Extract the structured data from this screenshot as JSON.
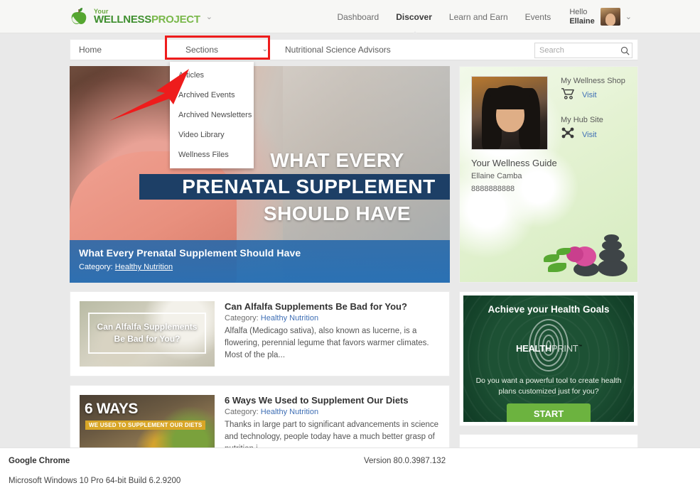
{
  "header": {
    "brand": {
      "line1": "Your",
      "wellness": "WELLNESS",
      "project": "PROJECT",
      "tm": "®",
      "caret": "⌄"
    },
    "nav": [
      {
        "label": "Dashboard",
        "active": false
      },
      {
        "label": "Discover",
        "active": true
      },
      {
        "label": "Learn and Earn",
        "active": false
      },
      {
        "label": "Events",
        "active": false
      }
    ],
    "greeting": "Hello",
    "user_name": "Ellaine",
    "user_caret": "⌄"
  },
  "subnav": {
    "home": "Home",
    "sections": "Sections",
    "sections_caret": "⌄",
    "advisors": "Nutritional Science Advisors",
    "search_placeholder": "Search",
    "search_value": ""
  },
  "dropdown": {
    "items": [
      {
        "label": "Articles"
      },
      {
        "label": "Archived Events"
      },
      {
        "label": "Archived Newsletters"
      },
      {
        "label": "Video Library"
      },
      {
        "label": "Wellness Files"
      }
    ]
  },
  "hero": {
    "overlay_line1": "WHAT EVERY",
    "overlay_line2": "PRENATAL SUPPLEMENT",
    "overlay_line3": "SHOULD HAVE",
    "title": "What Every Prenatal Supplement Should Have",
    "category_label": "Category:",
    "category": "Healthy Nutrition"
  },
  "articles": [
    {
      "thumb_line1": "Can Alfalfa Supplements",
      "thumb_line2": "Be Bad for You?",
      "title": "Can Alfalfa Supplements Be Bad for You?",
      "category_label": "Category:",
      "category": "Healthy Nutrition",
      "excerpt": "Alfalfa (Medicago sativa), also known as lucerne, is a flowering, perennial legume that favors warmer climates. Most of the pla..."
    },
    {
      "thumb_line1": "6 WAYS",
      "thumb_line2": "WE USED TO SUPPLEMENT OUR DIETS",
      "title": "6 Ways We Used to Supplement Our Diets",
      "category_label": "Category:",
      "category": "Healthy Nutrition",
      "excerpt": "Thanks in large part to significant advancements in science and technology, people today have a much better grasp of nutrition i..."
    }
  ],
  "sidebar": {
    "guide_label": "Your Wellness Guide",
    "guide_name": "Ellaine Camba",
    "guide_phone": "8888888888",
    "shop_title": "My Wellness Shop",
    "shop_link": "Visit",
    "hub_title": "My Hub Site",
    "hub_link": "Visit"
  },
  "promo": {
    "heading": "Achieve your Health Goals",
    "brand_bold": "HEALTH",
    "brand_light": "PRINT",
    "brand_tm": "™",
    "body": "Do you want a powerful tool to create health plans customized just for you?",
    "button": "START"
  },
  "footer": {
    "app": "Google Chrome",
    "version": "Version 80.0.3987.132",
    "os": "Microsoft Windows 10 Pro 64-bit Build 6.2.9200"
  },
  "colors": {
    "accent_green": "#6cb33f",
    "brand_green": "#3f8f2f",
    "link_blue": "#3f6fb5",
    "annotation_red": "#ee1c1c",
    "hero_blue": "#2467aa",
    "promo_green": "#1d5134"
  }
}
